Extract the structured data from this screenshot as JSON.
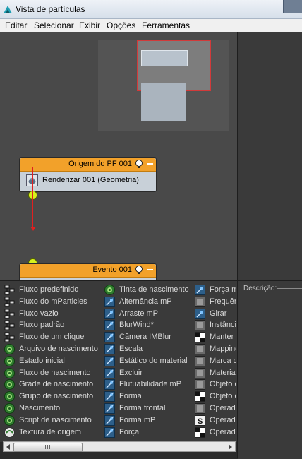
{
  "window": {
    "title": "Vista de partículas"
  },
  "menu": [
    "Editar",
    "Selecionar",
    "Exibir",
    "Opções",
    "Ferramentas"
  ],
  "nodes": {
    "origin": {
      "title": "Origem do PF 001",
      "row": "Renderizar 001 (Geometria)"
    },
    "event": {
      "title": "Evento 001"
    }
  },
  "depot": {
    "col1": [
      {
        "label": "Fluxo predefinido",
        "icon": "flow-icon"
      },
      {
        "label": "Fluxo do mParticles",
        "icon": "flow-icon"
      },
      {
        "label": "Fluxo vazio",
        "icon": "flow-icon"
      },
      {
        "label": "Fluxo padrão",
        "icon": "flow-icon"
      },
      {
        "label": "Fluxo de um clique",
        "icon": "flow-icon"
      },
      {
        "label": "Arquivo de nascimento",
        "icon": "birth-icon"
      },
      {
        "label": "Estado inicial",
        "icon": "birth-icon"
      },
      {
        "label": "Fluxo de nascimento",
        "icon": "birth-icon"
      },
      {
        "label": "Grade de nascimento",
        "icon": "birth-icon"
      },
      {
        "label": "Grupo de nascimento",
        "icon": "birth-icon"
      },
      {
        "label": "Nascimento",
        "icon": "birth-icon"
      },
      {
        "label": "Script de nascimento",
        "icon": "birth-icon"
      },
      {
        "label": "Textura de origem",
        "icon": "texture-icon"
      }
    ],
    "col2": [
      {
        "label": "Tinta de nascimento",
        "icon": "birth-icon"
      },
      {
        "label": "Alternância mP",
        "icon": "operator-icon"
      },
      {
        "label": "Arraste mP",
        "icon": "operator-icon"
      },
      {
        "label": "BlurWind*",
        "icon": "operator-icon"
      },
      {
        "label": "Câmera IMBlur",
        "icon": "operator-icon"
      },
      {
        "label": "Escala",
        "icon": "operator-icon"
      },
      {
        "label": "Estático do material",
        "icon": "operator-icon"
      },
      {
        "label": "Excluir",
        "icon": "operator-icon"
      },
      {
        "label": "Flutuabilidade mP",
        "icon": "operator-icon"
      },
      {
        "label": "Forma",
        "icon": "operator-icon"
      },
      {
        "label": "Forma frontal",
        "icon": "operator-icon"
      },
      {
        "label": "Forma mP",
        "icon": "operator-icon"
      },
      {
        "label": "Força",
        "icon": "operator-icon"
      }
    ],
    "col3": [
      {
        "label": "Força m",
        "icon": "operator-icon"
      },
      {
        "label": "Frequên",
        "icon": "gray-icon"
      },
      {
        "label": "Girar",
        "icon": "operator-icon"
      },
      {
        "label": "Instância",
        "icon": "gray-icon"
      },
      {
        "label": "Manter s",
        "icon": "checker-icon"
      },
      {
        "label": "Mapping",
        "icon": "gray-icon"
      },
      {
        "label": "Marca d",
        "icon": "gray-icon"
      },
      {
        "label": "Material",
        "icon": "gray-icon"
      },
      {
        "label": "Objeto c",
        "icon": "gray-icon"
      },
      {
        "label": "Objeto c",
        "icon": "checker-icon"
      },
      {
        "label": "Operado",
        "icon": "gray-icon"
      },
      {
        "label": "Operado",
        "icon": "script-icon"
      },
      {
        "label": "Operado",
        "icon": "checker-icon"
      }
    ]
  },
  "description": {
    "label": "Descrição:"
  },
  "scrollbar": {
    "grip": "|||"
  }
}
